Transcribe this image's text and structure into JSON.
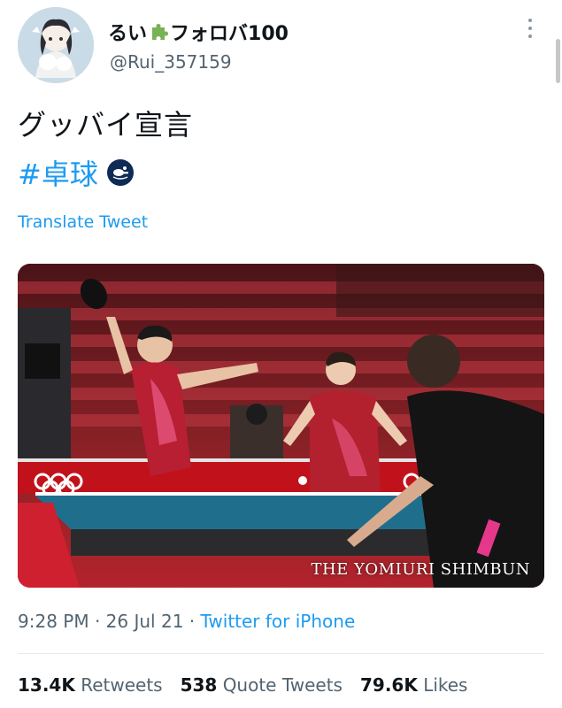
{
  "user": {
    "display_name_part1": "るい",
    "display_name_part2": "フォロバ100",
    "handle": "@Rui_357159",
    "avatar": "avatar-image"
  },
  "tweet": {
    "text": "グッバイ宣言",
    "hashtag": "#卓球",
    "hashflag_icon": "table-tennis-paddle-icon",
    "translate_label": "Translate Tweet"
  },
  "photo": {
    "watermark": "THE YOMIURI SHIMBUN"
  },
  "meta": {
    "time": "9:28 PM",
    "separator1": " · ",
    "date": "26 Jul 21",
    "separator2": " · ",
    "source": "Twitter for iPhone"
  },
  "stats": {
    "retweets_count": "13.4K",
    "retweets_label": "Retweets",
    "quotes_count": "538",
    "quotes_label": "Quote Tweets",
    "likes_count": "79.6K",
    "likes_label": "Likes"
  },
  "colors": {
    "link": "#1d9bf0",
    "secondary_text": "#536471"
  }
}
